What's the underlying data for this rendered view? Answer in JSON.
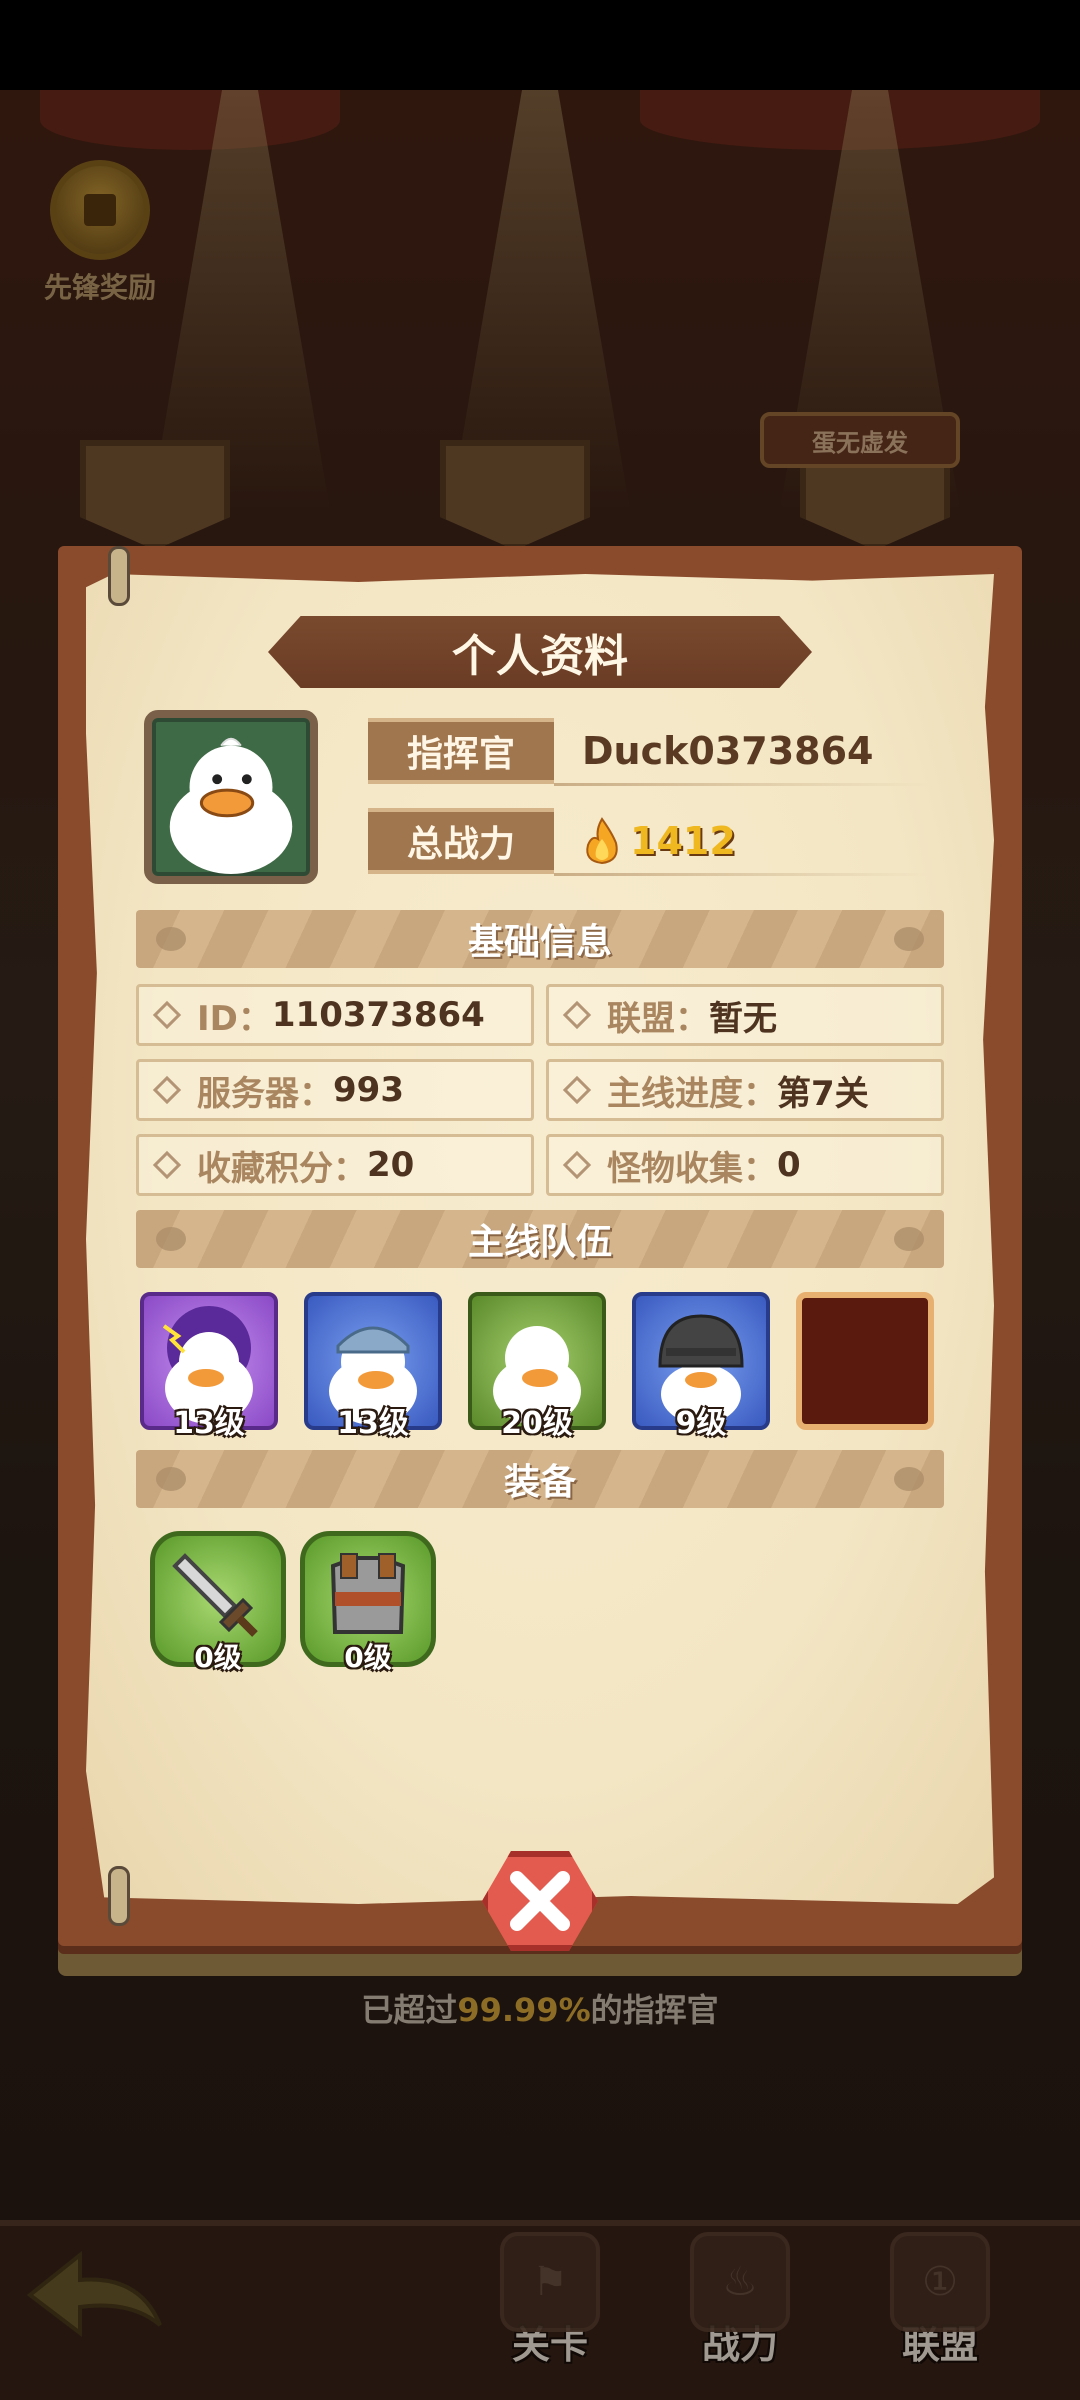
{
  "background": {
    "reward_label": "先锋奖励",
    "title_plaque": "蛋无虚发",
    "ranking_prefix": "已超过",
    "ranking_percent": "99.99%",
    "ranking_suffix": "的指挥官"
  },
  "profile": {
    "title": "个人资料",
    "commander_label": "指挥官",
    "commander_name": "Duck0373864",
    "power_label": "总战力",
    "power_value": "1412"
  },
  "sections": {
    "basic": "基础信息",
    "team": "主线队伍",
    "equipment": "装备"
  },
  "stats": [
    {
      "key": "ID：",
      "value": "110373864"
    },
    {
      "key": "联盟：",
      "value": "暂无"
    },
    {
      "key": "服务器：",
      "value": "993"
    },
    {
      "key": "主线进度：",
      "value": "第7关"
    },
    {
      "key": "收藏积分：",
      "value": "20"
    },
    {
      "key": "怪物收集：",
      "value": "0"
    }
  ],
  "team": [
    {
      "level": "13级",
      "rarity": "purple"
    },
    {
      "level": "13级",
      "rarity": "blue"
    },
    {
      "level": "20级",
      "rarity": "green"
    },
    {
      "level": "9级",
      "rarity": "blue"
    },
    {
      "level": "",
      "rarity": "empty"
    }
  ],
  "equipment": [
    {
      "level": "0级",
      "icon": "sword-icon"
    },
    {
      "level": "0级",
      "icon": "armor-icon"
    }
  ],
  "nav": {
    "stage": "关卡",
    "power": "战力",
    "alliance": "联盟"
  },
  "colors": {
    "accent_gold": "#d9a83a",
    "close_red": "#e35a4e",
    "parchment": "#f3e6c4"
  }
}
